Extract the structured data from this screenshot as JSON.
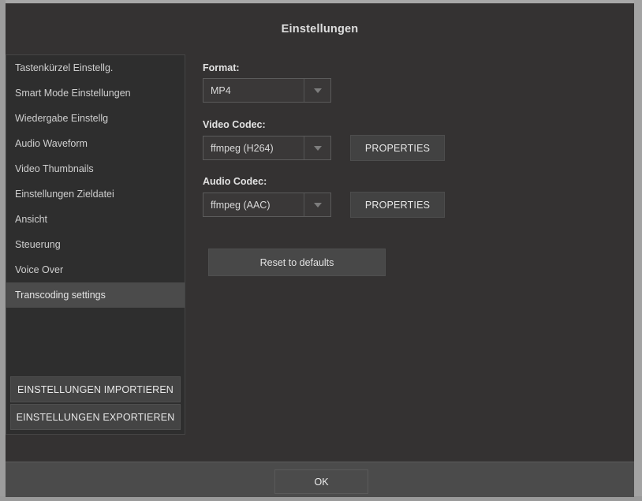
{
  "window": {
    "title": "Einstellungen"
  },
  "sidebar": {
    "items": [
      {
        "label": "Tastenkürzel Einstellg.",
        "selected": false
      },
      {
        "label": "Smart Mode Einstellungen",
        "selected": false
      },
      {
        "label": "Wiedergabe Einstellg",
        "selected": false
      },
      {
        "label": "Audio Waveform",
        "selected": false
      },
      {
        "label": "Video Thumbnails",
        "selected": false
      },
      {
        "label": "Einstellungen Zieldatei",
        "selected": false
      },
      {
        "label": "Ansicht",
        "selected": false
      },
      {
        "label": "Steuerung",
        "selected": false
      },
      {
        "label": "Voice Over",
        "selected": false
      },
      {
        "label": "Transcoding settings",
        "selected": true
      }
    ],
    "import_button": "EINSTELLUNGEN IMPORTIEREN",
    "export_button": "EINSTELLUNGEN EXPORTIEREN"
  },
  "main": {
    "format": {
      "label": "Format:",
      "value": "MP4"
    },
    "video_codec": {
      "label": "Video Codec:",
      "value": "ffmpeg (H264)",
      "properties_button": "PROPERTIES"
    },
    "audio_codec": {
      "label": "Audio Codec:",
      "value": "ffmpeg (AAC)",
      "properties_button": "PROPERTIES"
    },
    "reset_button": "Reset to defaults"
  },
  "footer": {
    "ok_button": "OK"
  },
  "icons": {
    "dropdown_arrow": "chevron-down-icon"
  },
  "colors": {
    "window_background": "#343232",
    "sidebar_background": "#2e2e2e",
    "selected_item": "#4b4b4b",
    "button_face": "#424242",
    "footer_background": "#4b4b4b",
    "text_primary": "#e2e2e2"
  }
}
